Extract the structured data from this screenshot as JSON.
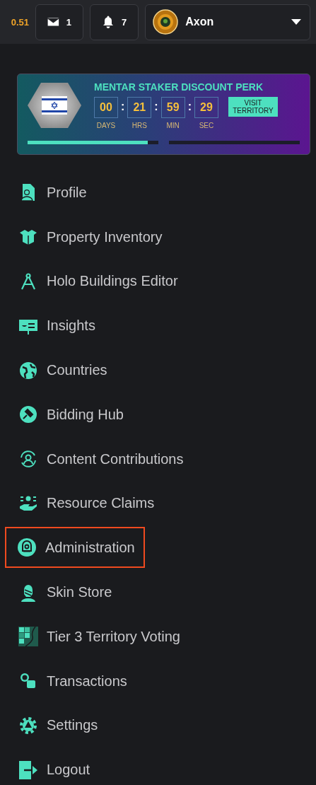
{
  "top_bar": {
    "balance": "0.51",
    "messages": {
      "count": "1"
    },
    "notifications": {
      "count": "7"
    },
    "account": {
      "name": "Axon"
    }
  },
  "perk": {
    "title": "MENTAR STAKER DISCOUNT PERK",
    "countdown": [
      {
        "value": "00",
        "label": "DAYS"
      },
      {
        "value": "21",
        "label": "HRS"
      },
      {
        "value": "59",
        "label": "MIN"
      },
      {
        "value": "29",
        "label": "SEC"
      }
    ],
    "separator": ":",
    "button": "VISIT TERRITORY",
    "progress": {
      "level": 0.92
    }
  },
  "menu": [
    {
      "label": "Profile",
      "kind": "profile",
      "highlighted": false
    },
    {
      "label": "Property Inventory",
      "kind": "box",
      "highlighted": false
    },
    {
      "label": "Holo Buildings Editor",
      "kind": "compass",
      "highlighted": false
    },
    {
      "label": "Insights",
      "kind": "board",
      "highlighted": false
    },
    {
      "label": "Countries",
      "kind": "globe",
      "highlighted": false
    },
    {
      "label": "Bidding Hub",
      "kind": "gavel",
      "highlighted": false
    },
    {
      "label": "Content Contributions",
      "kind": "person-cycle",
      "highlighted": false
    },
    {
      "label": "Resource Claims",
      "kind": "hand",
      "highlighted": false
    },
    {
      "label": "Administration",
      "kind": "admin",
      "highlighted": true
    },
    {
      "label": "Skin Store",
      "kind": "head",
      "highlighted": false
    },
    {
      "label": "Tier 3 Territory Voting",
      "kind": "map",
      "highlighted": false
    },
    {
      "label": "Transactions",
      "kind": "coins",
      "highlighted": false
    },
    {
      "label": "Settings",
      "kind": "gear",
      "highlighted": false
    },
    {
      "label": "Logout",
      "kind": "logout",
      "highlighted": false
    }
  ]
}
